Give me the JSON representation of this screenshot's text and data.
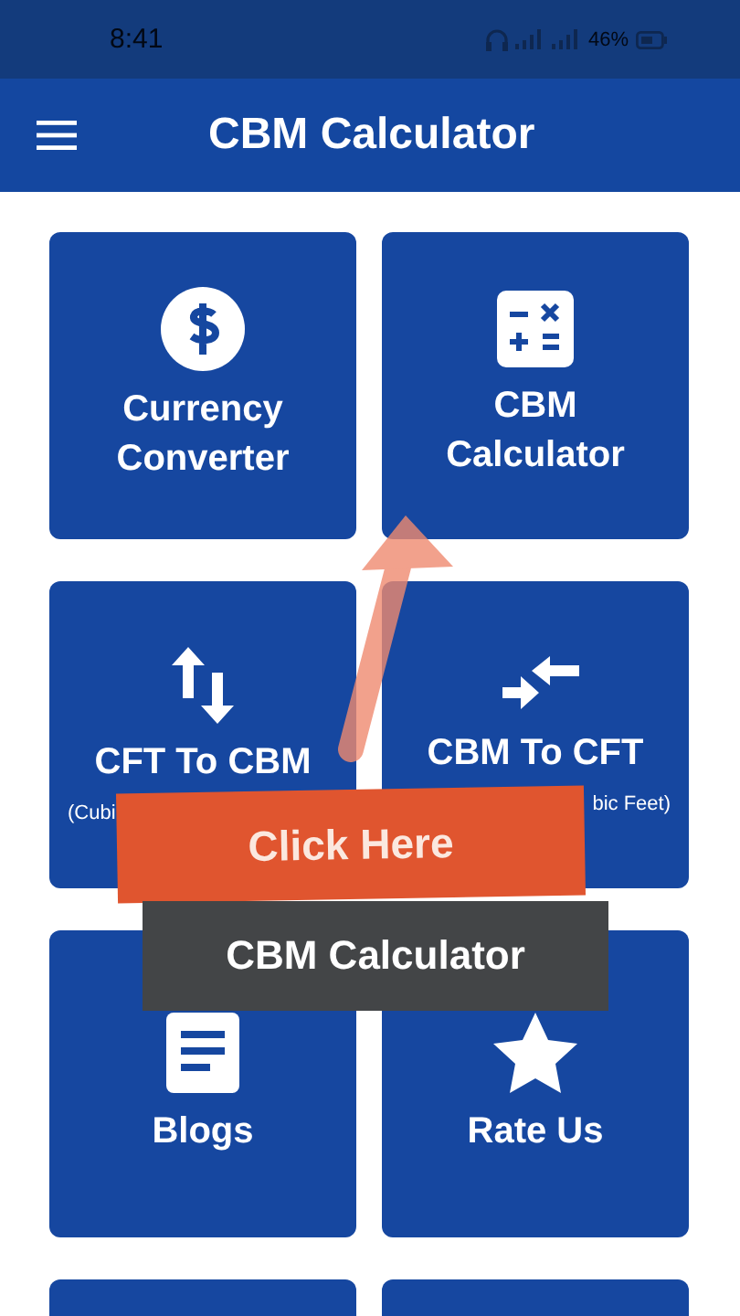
{
  "status_bar": {
    "time": "8:41",
    "battery": "46%"
  },
  "app_bar": {
    "title": "CBM Calculator"
  },
  "tiles": [
    {
      "kind": "dollar",
      "title": [
        "Currency",
        "Converter"
      ]
    },
    {
      "kind": "calculator",
      "title": [
        "CBM",
        "Calculator"
      ]
    },
    {
      "kind": "updown",
      "title": [
        "CFT To CBM"
      ],
      "subtitle": "(Cubi"
    },
    {
      "kind": "compress",
      "title": [
        "CBM To CFT"
      ],
      "subtitle": "bic Feet)"
    },
    {
      "kind": "document",
      "title": [
        "Blogs"
      ]
    },
    {
      "kind": "star",
      "title": [
        "Rate Us"
      ]
    },
    {
      "kind": "blank"
    },
    {
      "kind": "blank"
    }
  ],
  "overlay": {
    "banner": "Click Here",
    "caption": "CBM Calculator"
  }
}
